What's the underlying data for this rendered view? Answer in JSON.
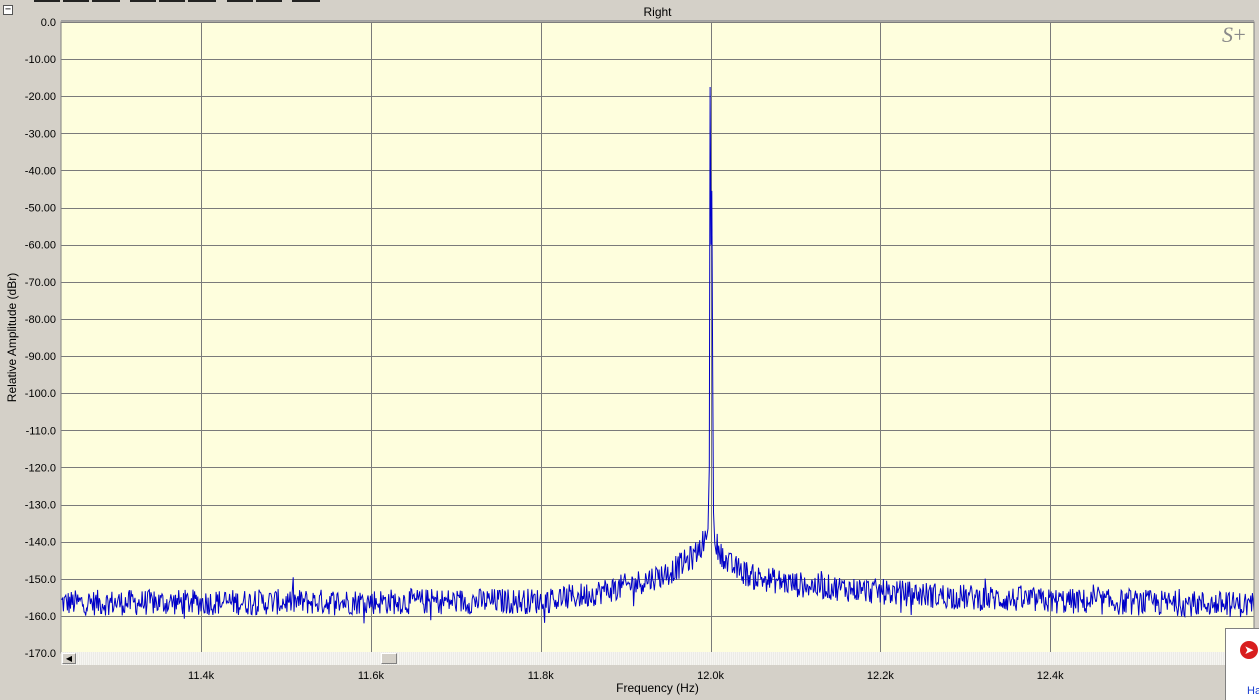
{
  "window": {
    "collapse_glyph": "−",
    "watermark": "S+",
    "corner_icon": "arrow-right-icon",
    "corner_text": "Ha"
  },
  "colors": {
    "plot_background": "#fefedd",
    "trace": "#0000c8",
    "grid": "#7a7a7a",
    "frame": "#d4d0c8"
  },
  "chart_data": {
    "type": "line",
    "title": "Right",
    "xlabel": "Frequency (Hz)",
    "ylabel": "Relative Amplitude (dBr)",
    "xlim": [
      11235,
      12640
    ],
    "ylim": [
      -170.0,
      0.0
    ],
    "x_ticks": [
      11400,
      11600,
      11800,
      12000,
      12200,
      12400
    ],
    "x_tick_labels": [
      "11.4k",
      "11.6k",
      "11.8k",
      "12.0k",
      "12.2k",
      "12.4k"
    ],
    "y_ticks": [
      0,
      -10,
      -20,
      -30,
      -40,
      -50,
      -60,
      -70,
      -80,
      -90,
      -100,
      -110,
      -120,
      -130,
      -140,
      -150,
      -160,
      -170
    ],
    "y_tick_labels": [
      "0.0",
      "-10.00",
      "-20.00",
      "-30.00",
      "-40.00",
      "-50.00",
      "-60.00",
      "-70.00",
      "-80.00",
      "-90.00",
      "-100.0",
      "-110.0",
      "-120.0",
      "-130.0",
      "-140.0",
      "-150.0",
      "-160.0",
      "-170.0"
    ],
    "grid": true,
    "series": [
      {
        "peak": {
          "x": 12000,
          "y": -17.5
        },
        "secondary_peak": {
          "x": 12002,
          "y": -45.5
        },
        "noise_floor_level": -156.5,
        "envelope": [
          [
            11235,
            -156.5
          ],
          [
            11800,
            -156.0
          ],
          [
            11850,
            -154.5
          ],
          [
            11900,
            -152.0
          ],
          [
            11950,
            -148.5
          ],
          [
            11980,
            -144.0
          ],
          [
            11995,
            -139.0
          ],
          [
            12000,
            -17.5
          ],
          [
            12005,
            -140.0
          ],
          [
            12020,
            -146.0
          ],
          [
            12050,
            -149.5
          ],
          [
            12100,
            -151.5
          ],
          [
            12200,
            -153.5
          ],
          [
            12300,
            -155.0
          ],
          [
            12400,
            -156.0
          ],
          [
            12640,
            -157.0
          ]
        ]
      }
    ]
  }
}
